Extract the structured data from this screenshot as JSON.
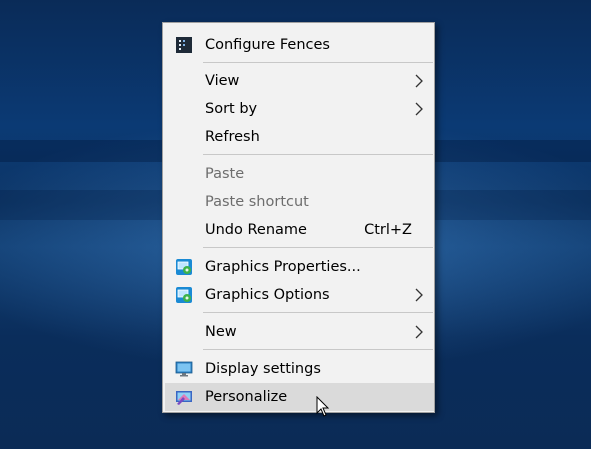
{
  "context_menu": {
    "items": {
      "configure_fences": {
        "label": "Configure Fences",
        "icon": "fences-icon"
      },
      "view": {
        "label": "View",
        "submenu": true
      },
      "sort_by": {
        "label": "Sort by",
        "submenu": true
      },
      "refresh": {
        "label": "Refresh"
      },
      "paste": {
        "label": "Paste",
        "disabled": true
      },
      "paste_shortcut": {
        "label": "Paste shortcut",
        "disabled": true
      },
      "undo_rename": {
        "label": "Undo Rename",
        "shortcut": "Ctrl+Z"
      },
      "graphics_properties": {
        "label": "Graphics Properties...",
        "icon": "intel-graphics-icon"
      },
      "graphics_options": {
        "label": "Graphics Options",
        "icon": "intel-graphics-icon",
        "submenu": true
      },
      "new": {
        "label": "New",
        "submenu": true
      },
      "display_settings": {
        "label": "Display settings",
        "icon": "display-monitor-icon"
      },
      "personalize": {
        "label": "Personalize",
        "icon": "personalize-icon",
        "highlighted": true
      }
    }
  },
  "colors": {
    "menu_background": "#f2f2f2",
    "hover_background": "#dadada",
    "disabled_text": "#6d6d6d",
    "desktop_blue": "#0b3a74"
  }
}
